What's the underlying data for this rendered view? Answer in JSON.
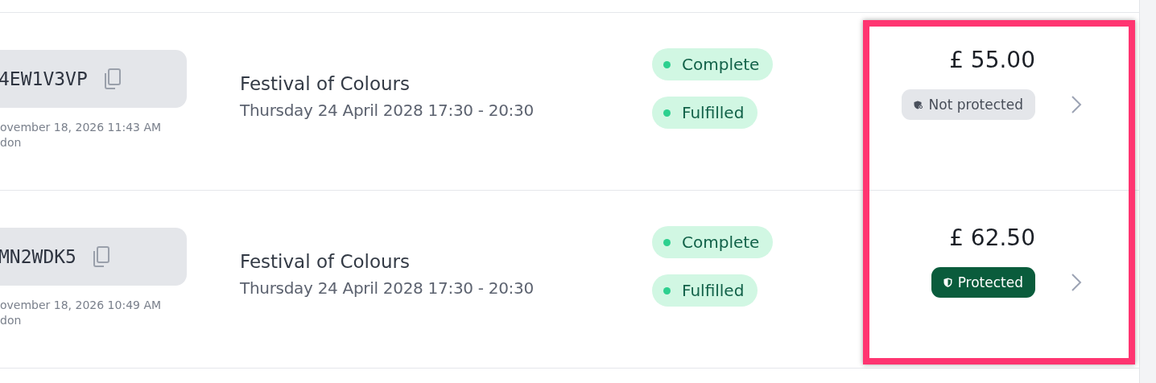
{
  "orders": [
    {
      "code": "4EW1V3VP",
      "date": "ovember 18, 2026 11:43 AM",
      "location": "don",
      "event": "Festival of Colours",
      "event_time": "Thursday 24 April 2028 17:30 - 20:30",
      "statuses": [
        "Complete",
        "Fulfilled"
      ],
      "price": "£ 55.00",
      "protection": {
        "kind": "not_protected",
        "label": "Not protected"
      }
    },
    {
      "code": "MN2WDK5",
      "date": "ovember 18, 2026 10:49 AM",
      "location": "don",
      "event": "Festival of Colours",
      "event_time": "Thursday 24 April 2028 17:30 - 20:30",
      "statuses": [
        "Complete",
        "Fulfilled"
      ],
      "price": "£ 62.50",
      "protection": {
        "kind": "protected",
        "label": "Protected"
      }
    }
  ]
}
